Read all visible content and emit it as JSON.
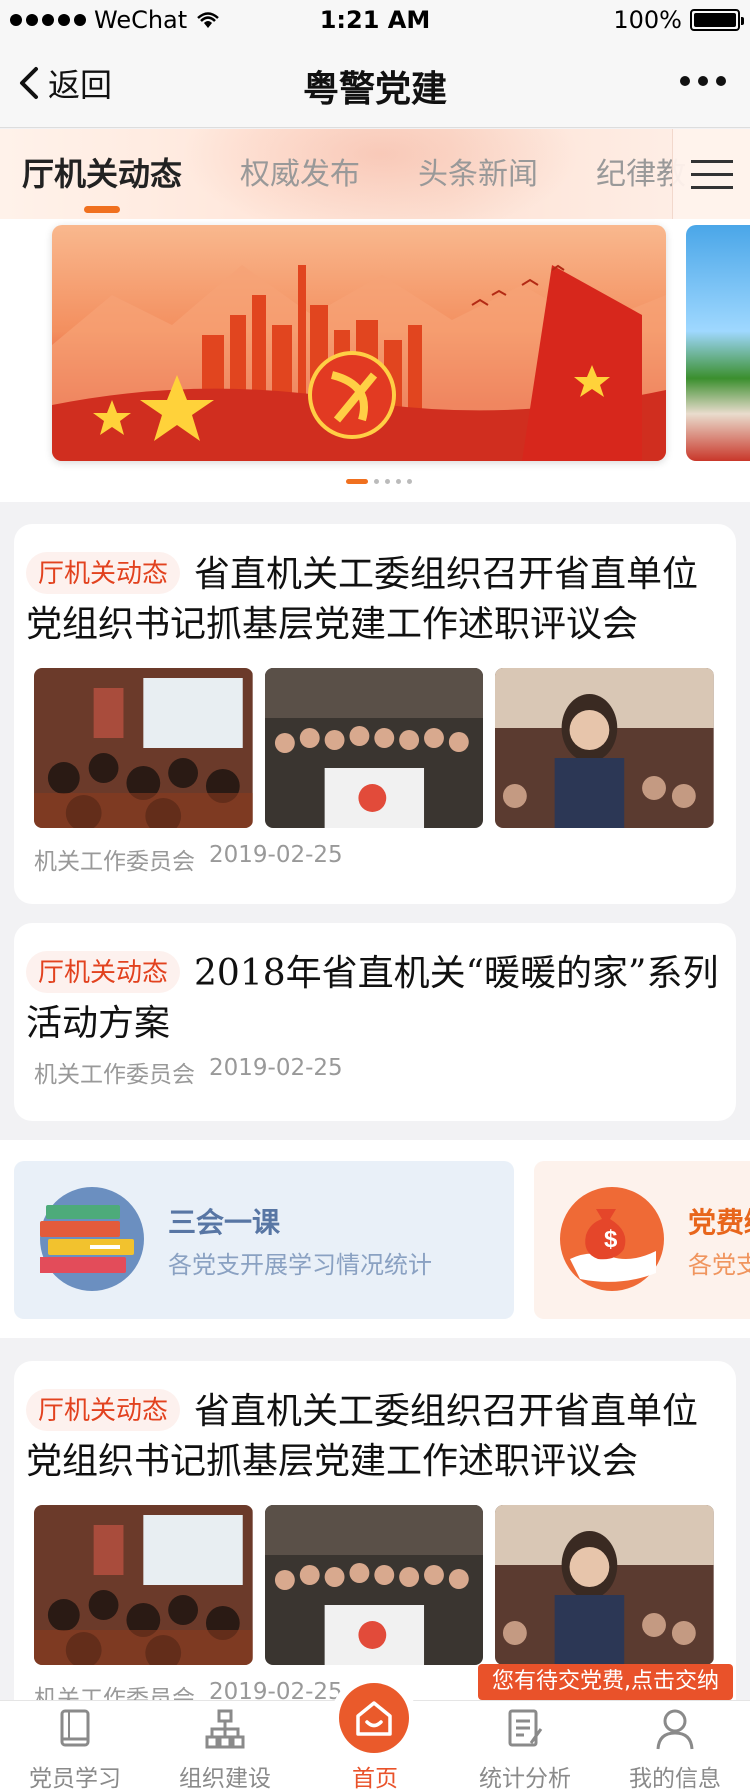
{
  "status_bar": {
    "carrier": "WeChat",
    "time": "1:21 AM",
    "battery": "100%"
  },
  "nav": {
    "back_label": "返回",
    "title": "粤警党建"
  },
  "tabs": [
    {
      "label": "厅机关动态",
      "active": true
    },
    {
      "label": "权威发布",
      "active": false
    },
    {
      "label": "头条新闻",
      "active": false
    },
    {
      "label": "纪律教",
      "active": false
    }
  ],
  "banner": {
    "slide_count": 5,
    "active_index": 0
  },
  "articles": [
    {
      "tag": "厅机关动态",
      "title": "省直机关工委组织召开省直单位党组织书记抓基层党建工作述职评议会",
      "source": "机关工作委员会",
      "date": "2019-02-25",
      "images": 3
    },
    {
      "tag": "厅机关动态",
      "title": "2018年省直机关“暖暖的家”系列活动方案",
      "source": "机关工作委员会",
      "date": "2019-02-25",
      "images": 0
    },
    {
      "tag": "厅机关动态",
      "title": "省直机关工委组织召开省直单位党组织书记抓基层党建工作述职评议会",
      "source": "机关工作委员会",
      "date": "2019-02-25",
      "images": 3
    }
  ],
  "features": [
    {
      "title": "三会一课",
      "subtitle": "各党支开展学习情况统计"
    },
    {
      "title": "党费缴",
      "subtitle": "各党支"
    }
  ],
  "toast": "您有待交党费,点击交纳",
  "tabbar": [
    {
      "label": "党员学习",
      "icon": "book-icon"
    },
    {
      "label": "组织建设",
      "icon": "org-chart-icon"
    },
    {
      "label": "首页",
      "icon": "home-icon",
      "active": true
    },
    {
      "label": "统计分析",
      "icon": "report-icon"
    },
    {
      "label": "我的信息",
      "icon": "user-icon"
    }
  ],
  "colors": {
    "accent": "#e9522a",
    "tab_underline": "#f0701f",
    "tag_text": "#e2421f"
  }
}
